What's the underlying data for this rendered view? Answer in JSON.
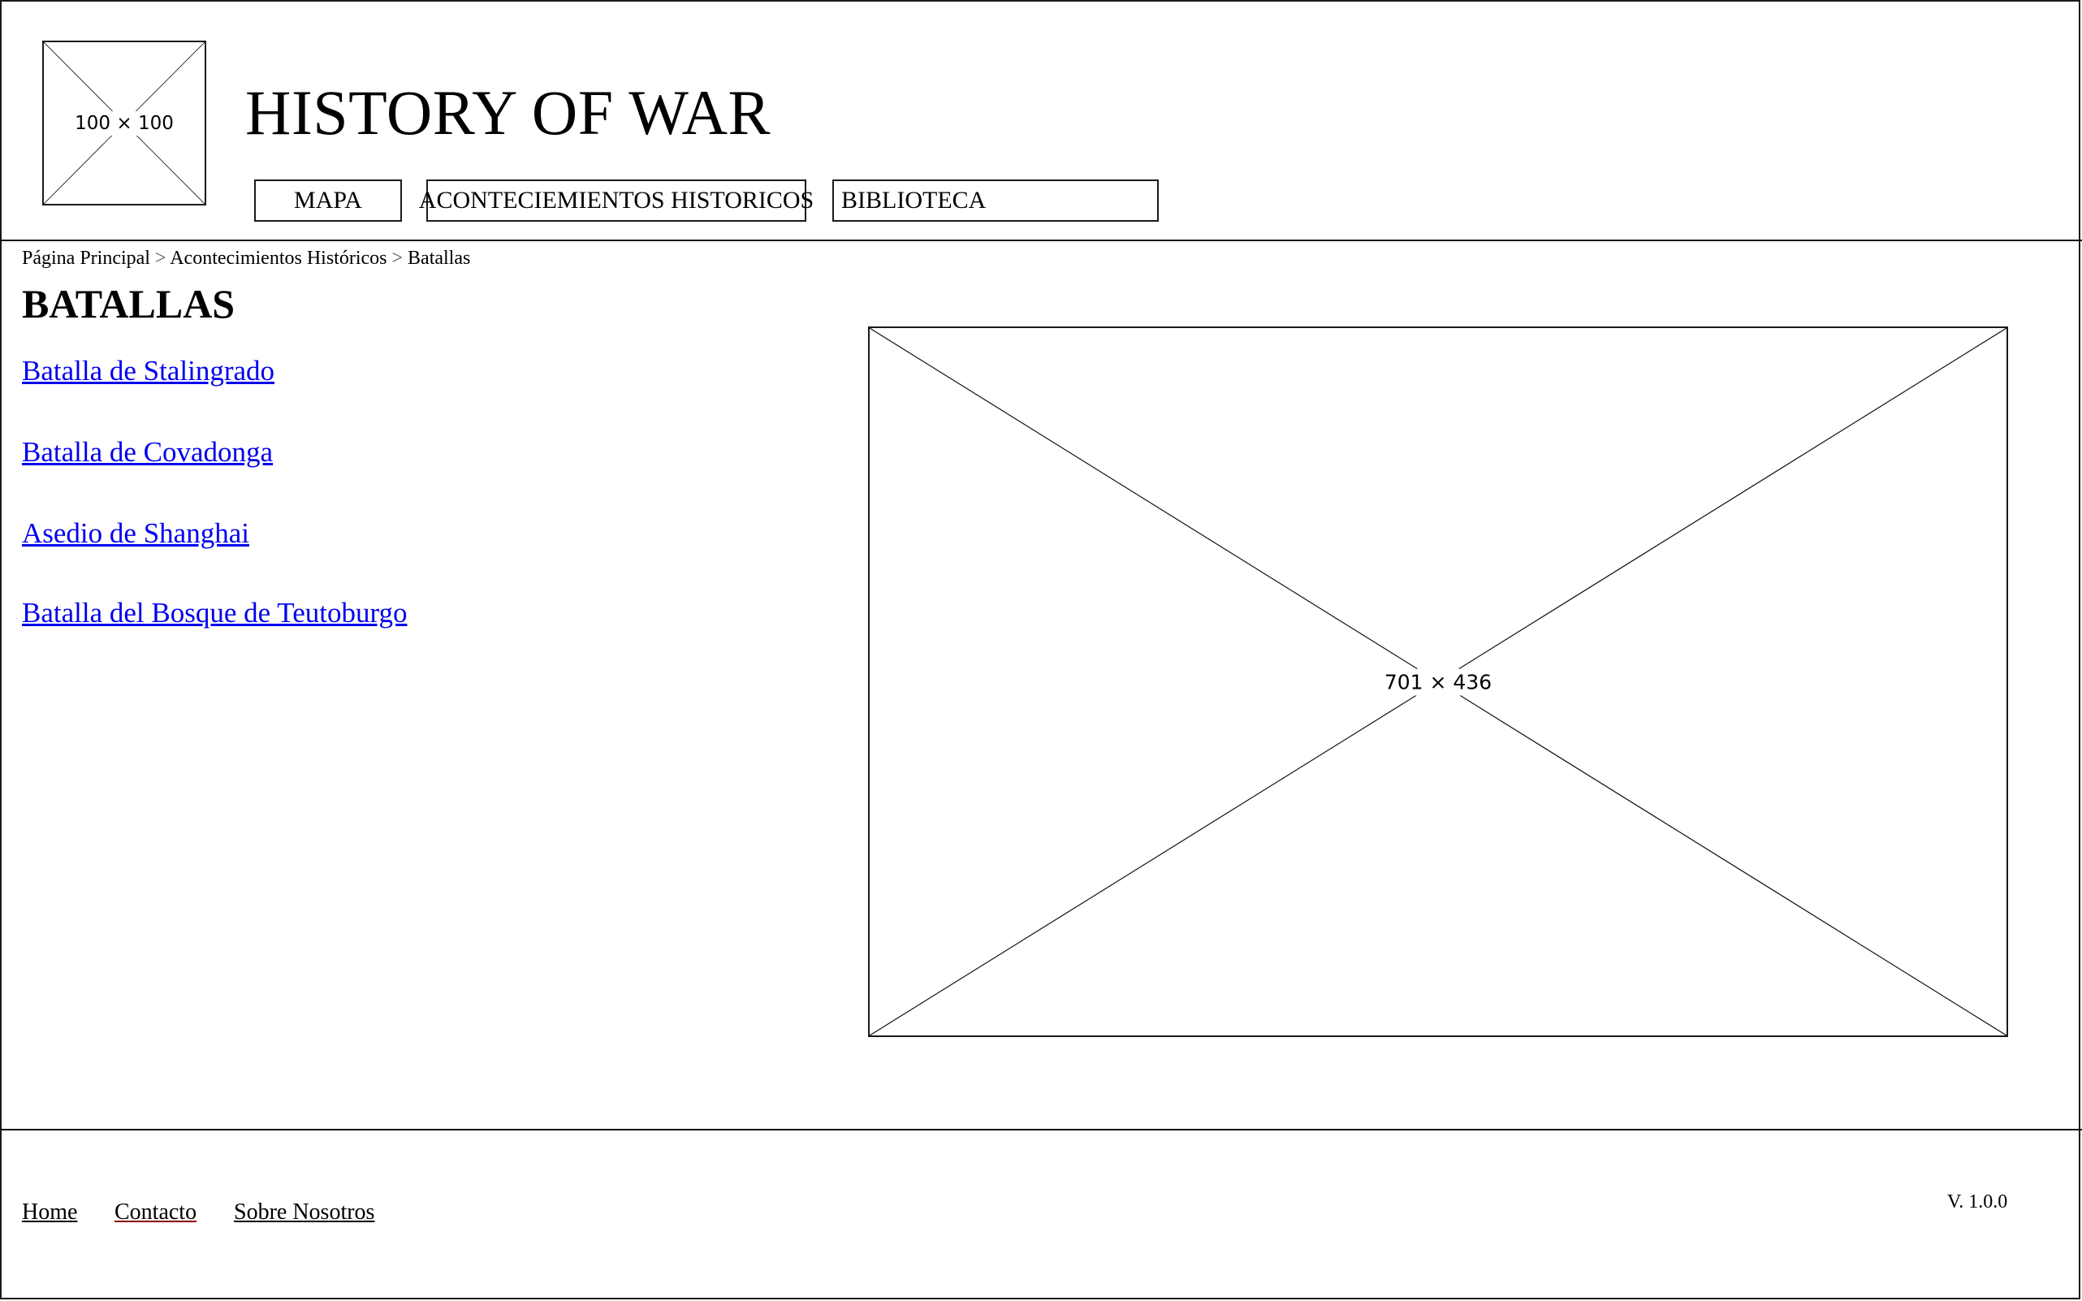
{
  "header": {
    "logo_placeholder": "100 × 100",
    "title": "HISTORY OF WAR",
    "nav": [
      {
        "label": "MAPA"
      },
      {
        "label": "ACONTECIEMIENTOS HISTORICOS"
      },
      {
        "label": "BIBLIOTECA"
      }
    ]
  },
  "breadcrumb": {
    "items": [
      "Página Principal",
      "Acontecimientos Históricos",
      "Batallas"
    ],
    "separator": ">"
  },
  "main": {
    "heading": "BATALLAS",
    "battles": [
      {
        "label": "Batalla de Stalingrado"
      },
      {
        "label": "Batalla de Covadonga"
      },
      {
        "label": "Asedio de Shanghai"
      },
      {
        "label": "Batalla del Bosque de Teutoburgo"
      }
    ],
    "image_placeholder": "701 × 436"
  },
  "footer": {
    "links": [
      {
        "label": "Home"
      },
      {
        "label": "Contacto"
      },
      {
        "label": "Sobre Nosotros"
      }
    ],
    "version": "V. 1.0.0"
  },
  "colors": {
    "link": "#0000ee",
    "footer_link": "#000000",
    "footer_link_active_underline": "#8b0000",
    "border": "#1a1a1a"
  }
}
